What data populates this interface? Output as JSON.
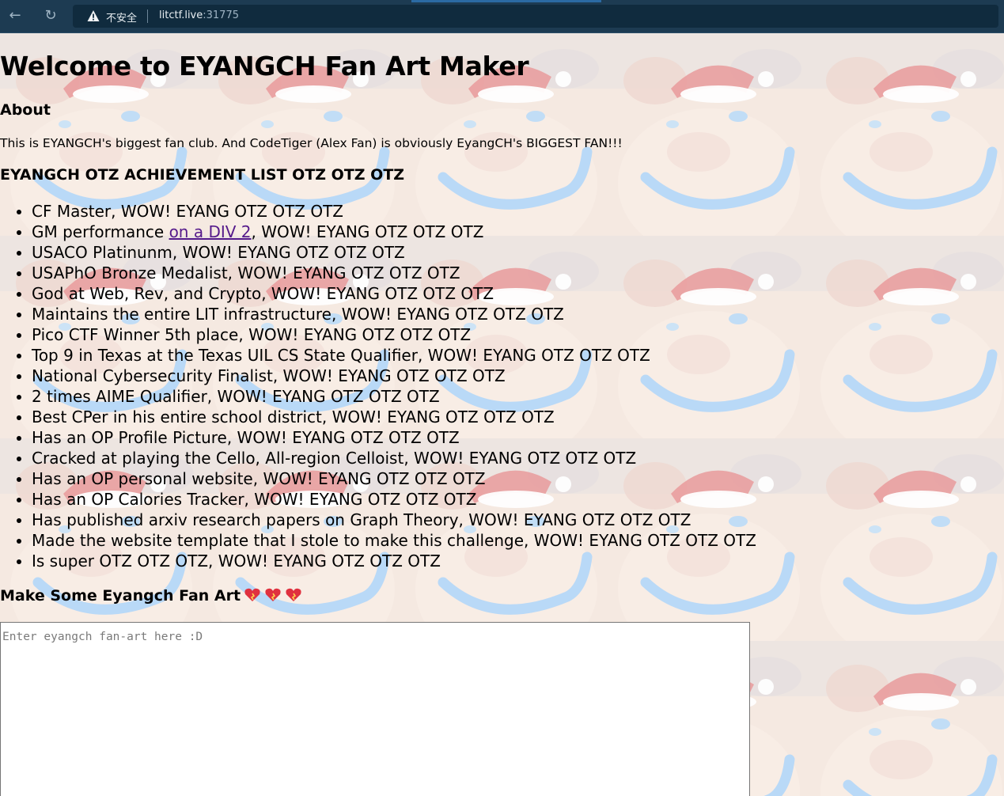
{
  "browser": {
    "security_label": "不安全",
    "url_host": "litctf.live",
    "url_port": ":31775"
  },
  "page": {
    "title": "Welcome to EYANGCH Fan Art Maker",
    "about_heading": "About",
    "about_text": "This is EYANGCH's biggest fan club. And CodeTiger (Alex Fan) is obviously EyangCH's BIGGEST FAN!!!",
    "achievements_heading": "EYANGCH OTZ ACHIEVEMENT LIST OTZ OTZ OTZ",
    "achievements": [
      {
        "text": "CF Master, WOW! EYANG OTZ OTZ OTZ"
      },
      {
        "before": "GM performance ",
        "link": "on a DIV 2",
        "after": ", WOW! EYANG OTZ OTZ OTZ"
      },
      {
        "text": "USACO Platinunm, WOW! EYANG OTZ OTZ OTZ"
      },
      {
        "text": "USAPhO Bronze Medalist, WOW! EYANG OTZ OTZ OTZ"
      },
      {
        "text": "God at Web, Rev, and Crypto, WOW! EYANG OTZ OTZ OTZ"
      },
      {
        "text": "Maintains the entire LIT infrastructure, WOW! EYANG OTZ OTZ OTZ"
      },
      {
        "text": "Pico CTF Winner 5th place, WOW! EYANG OTZ OTZ OTZ"
      },
      {
        "text": "Top 9 in Texas at the Texas UIL CS State Qualifier, WOW! EYANG OTZ OTZ OTZ"
      },
      {
        "text": "National Cybersecurity Finalist, WOW! EYANG OTZ OTZ OTZ"
      },
      {
        "text": "2 times AIME Qualifier, WOW! EYANG OTZ OTZ OTZ"
      },
      {
        "text": "Best CPer in his entire school district, WOW! EYANG OTZ OTZ OTZ"
      },
      {
        "text": "Has an OP Profile Picture, WOW! EYANG OTZ OTZ OTZ"
      },
      {
        "text": "Cracked at playing the Cello, All-region Celloist, WOW! EYANG OTZ OTZ OTZ"
      },
      {
        "text": "Has an OP personal website, WOW! EYANG OTZ OTZ OTZ"
      },
      {
        "text": "Has an OP Calories Tracker, WOW! EYANG OTZ OTZ OTZ"
      },
      {
        "text": "Has published arxiv research papers on Graph Theory, WOW! EYANG OTZ OTZ OTZ"
      },
      {
        "text": "Made the website template that I stole to make this challenge, WOW! EYANG OTZ OTZ OTZ"
      },
      {
        "text": "Is super OTZ OTZ OTZ, WOW! EYANG OTZ OTZ OTZ"
      }
    ],
    "fanart_heading": "Make Some Eyangch Fan Art",
    "fanart_placeholder": "Enter eyangch fan-art here :D"
  },
  "colors": {
    "chrome": "#1d3b52",
    "link_visited": "#551a8b",
    "smile": "#8ec4f2",
    "hat_red": "#d9484e"
  }
}
